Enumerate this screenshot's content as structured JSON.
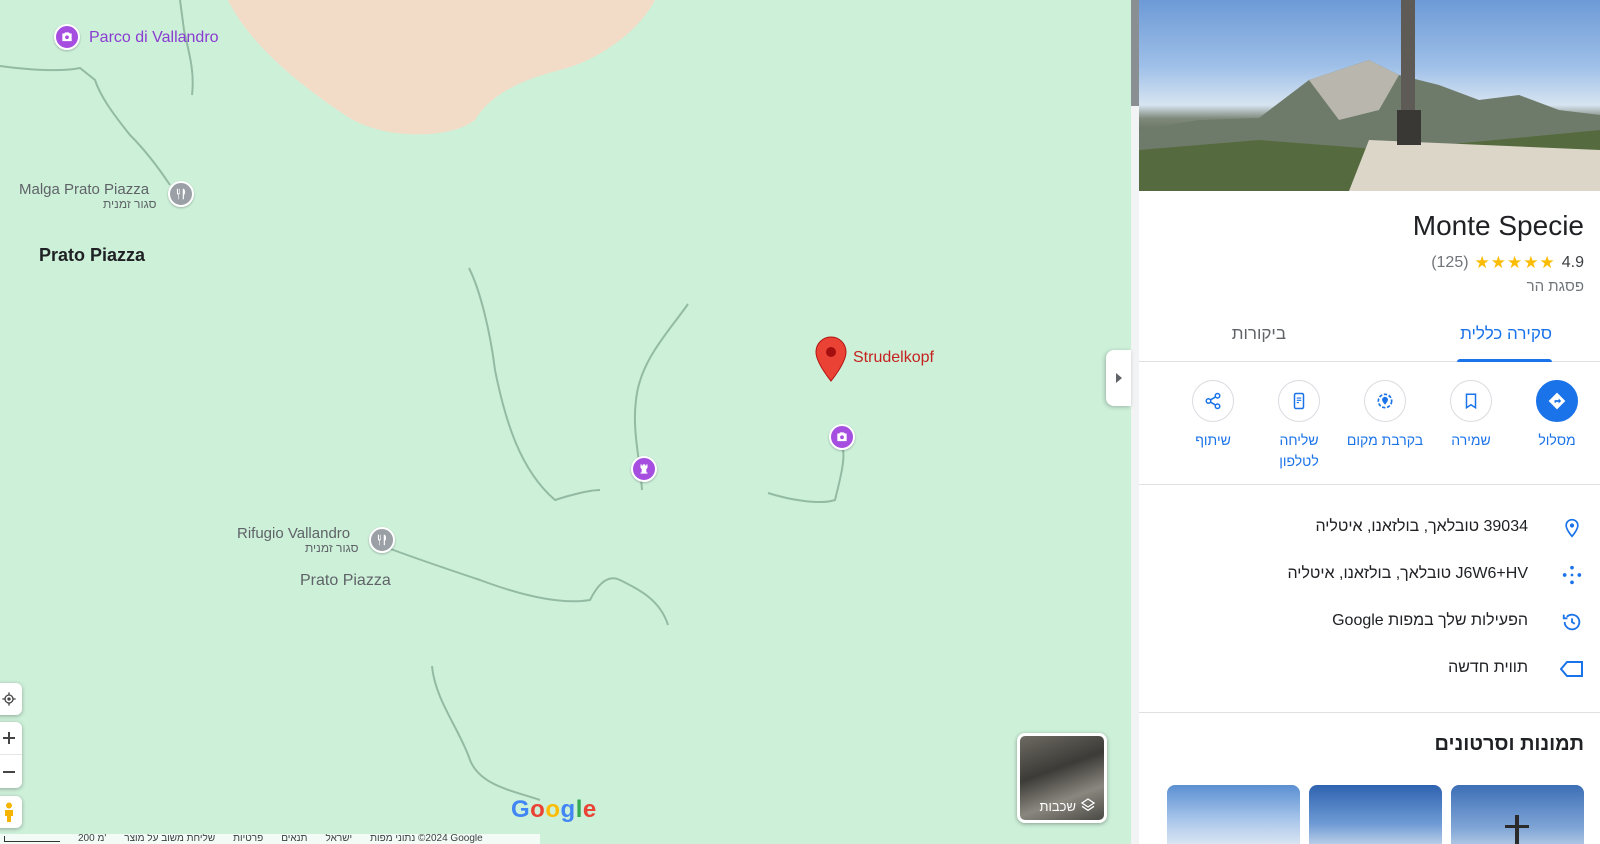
{
  "map": {
    "labels": {
      "parco": "Parco di Vallandro",
      "malga": "Malga Prato Piazza",
      "malga_sub": "סגור זמנית",
      "prato_bold": "Prato Piazza",
      "strudelkopf": "Strudelkopf",
      "rifugio": "Rifugio Vallandro",
      "rifugio_sub": "סגור זמנית",
      "prato_grey": "Prato Piazza"
    },
    "icons": {
      "camera": "camera-icon",
      "restaurant": "fork-knife-icon",
      "castle": "castle-icon",
      "red_pin": "red-pin-icon"
    },
    "layers_label": "שכבות",
    "google_logo": "Google",
    "footer": {
      "data": "נתוני מפות ‎©2024 Google",
      "israel": "ישראל",
      "terms": "תנאים",
      "privacy": "פרטיות",
      "feedback": "שליחת משוב על מוצר",
      "scale": "200 מ'"
    },
    "colors": {
      "land": "#cdf0d9",
      "sand": "#f3d8c1",
      "trail": "#8fb8a0",
      "poi_purple": "#a64ee0",
      "poi_grey": "#9aa0a6",
      "pin_red": "#ea4335"
    }
  },
  "panel": {
    "title": "Monte Specie",
    "rating": "4.9",
    "stars": "★★★★★",
    "review_count": "(125)",
    "category": "פסגת הר",
    "tabs": {
      "overview": "סקירה כללית",
      "reviews": "ביקורות"
    },
    "actions": {
      "directions": "מסלול",
      "save": "שמירה",
      "nearby": "בקרבת מקום",
      "send_phone_1": "שליחה",
      "send_phone_2": "לטלפון",
      "share": "שיתוף"
    },
    "info": {
      "address": "39034 טובלאך, בולזאנו, איטליה",
      "plus_code": "J6W6+HV טובלאך, בולזאנו, איטליה",
      "activity": "הפעילות שלך במפות Google",
      "label": "תווית חדשה"
    },
    "photos_title": "תמונות וסרטונים",
    "accent": "#1a73e8"
  }
}
